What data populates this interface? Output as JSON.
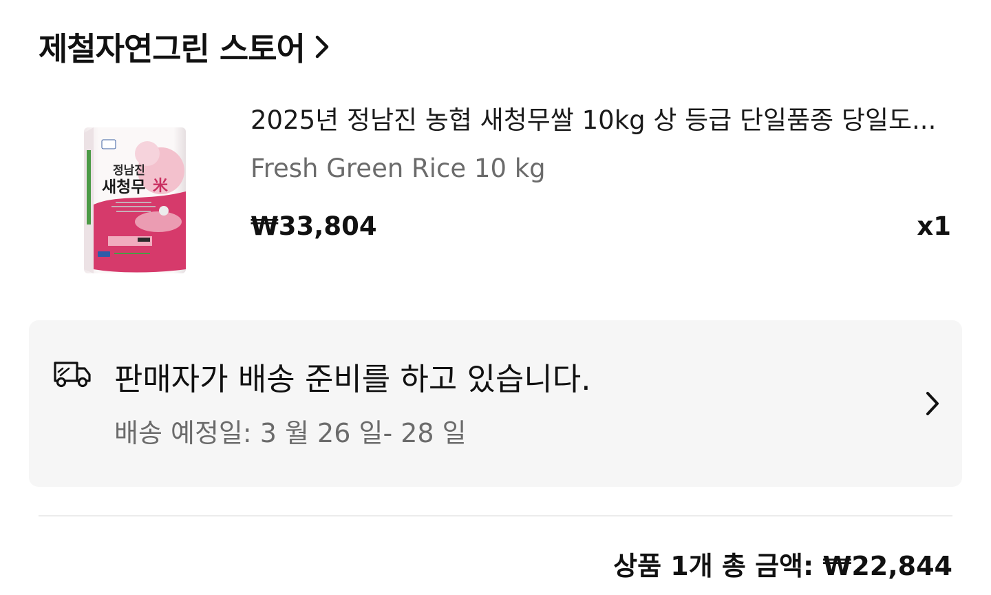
{
  "store": {
    "name": "제철자연그린 스토어",
    "chevron_icon": "chevron-right-icon"
  },
  "product": {
    "title": "2025년 정남진 농협 새청무쌀 10kg 상 등급 단일품종 당일도...",
    "option": "Fresh Green Rice 10 kg",
    "price": "₩33,804",
    "quantity": "x1",
    "image": {
      "icon": "rice-bag-product-image",
      "package_text_line1": "정남진",
      "package_text_line2": "새청무",
      "package_text_hanja": "米",
      "colors": {
        "bag_white": "#f7f4f4",
        "bag_pink": "#d63a6b",
        "bag_light_pink": "#f3c1cd",
        "label_green": "#4c9a46",
        "label_blue": "#2f5ca8"
      }
    }
  },
  "delivery": {
    "icon": "delivery-truck-icon",
    "status": "판매자가 배송 준비를 하고 있습니다.",
    "eta": "배송 예정일: 3 월 26 일- 28 일",
    "chevron_icon": "chevron-right-icon"
  },
  "summary": {
    "total": "상품 1개 총 금액: ₩22,844"
  },
  "colors": {
    "text_primary": "#111111",
    "text_secondary": "#6b6b6b",
    "card_background": "#f6f6f6",
    "divider": "#ececec"
  }
}
